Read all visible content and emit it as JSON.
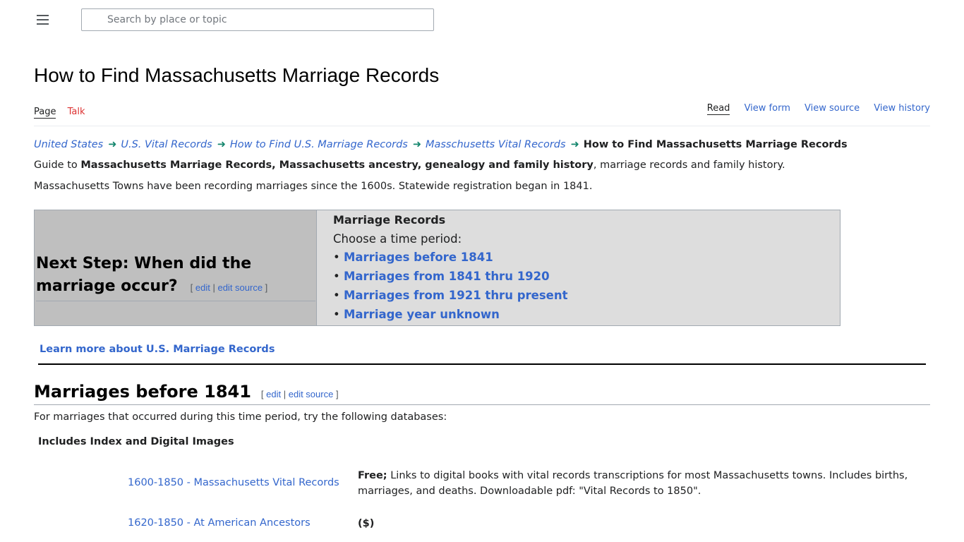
{
  "search": {
    "placeholder": "Search by place or topic"
  },
  "page_title": "How to Find Massachusetts Marriage Records",
  "namespace_tabs": {
    "page": "Page",
    "talk": "Talk"
  },
  "view_tabs": {
    "read": "Read",
    "view_form": "View form",
    "view_source": "View source",
    "view_history": "View history"
  },
  "breadcrumb": {
    "items": [
      "United States",
      "U.S. Vital Records",
      "How to Find U.S. Marriage Records",
      "Masschusetts Vital Records"
    ],
    "separator": "➜",
    "current": "How to Find Massachusetts Marriage Records"
  },
  "intro": {
    "prefix": "Guide to ",
    "bold": "Massachusetts Marriage Records, Massachusetts ancestry, genealogy and family history",
    "suffix": ", marriage records and family history.",
    "line2": "Massachusetts Towns have been recording marriages since the 1600s. Statewide registration began in 1841."
  },
  "edit_links": {
    "open": "[ ",
    "edit": "edit",
    "sep": " | ",
    "edit_source": "edit source",
    "close": " ]"
  },
  "next_step": {
    "heading_line1": "Next Step: When did the",
    "heading_line2": "marriage occur?",
    "box_title": "Marriage Records",
    "choose": "Choose a time period:",
    "bullet": "•",
    "periods": [
      "Marriages before 1841",
      "Marriages from 1841 thru 1920",
      "Marriages from 1921 thru present",
      "Marriage year unknown"
    ]
  },
  "learn_more": "Learn more about U.S. Marriage Records",
  "section": {
    "title": "Marriages before 1841",
    "intro": "For marriages that occurred during this time period, try the following databases:",
    "subheading": "Includes Index and Digital Images",
    "databases": [
      {
        "name": "1600-1850 - Massachusetts Vital Records",
        "cost": "Free;",
        "desc": " Links to digital books with vital records transcriptions for most Massachusetts towns. Includes births, marriages, and deaths. Downloadable pdf: \"Vital Records to 1850\"."
      },
      {
        "name": "1620-1850 - At American Ancestors",
        "cost": "($)",
        "desc": ""
      }
    ]
  },
  "colors": {
    "link": "#3366cc",
    "talk_red": "#dd3333",
    "arrow_green": "#14866d",
    "left_panel": "#bfbfbf",
    "right_panel": "#dddddd"
  }
}
